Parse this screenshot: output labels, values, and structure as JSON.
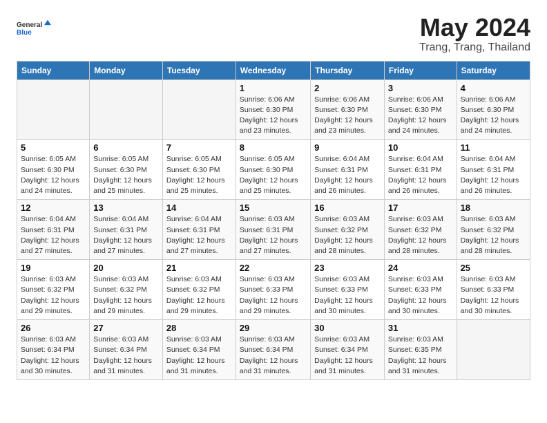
{
  "header": {
    "logo_general": "General",
    "logo_blue": "Blue",
    "month_title": "May 2024",
    "location": "Trang, Trang, Thailand"
  },
  "weekdays": [
    "Sunday",
    "Monday",
    "Tuesday",
    "Wednesday",
    "Thursday",
    "Friday",
    "Saturday"
  ],
  "weeks": [
    [
      {
        "day": "",
        "info": ""
      },
      {
        "day": "",
        "info": ""
      },
      {
        "day": "",
        "info": ""
      },
      {
        "day": "1",
        "info": "Sunrise: 6:06 AM\nSunset: 6:30 PM\nDaylight: 12 hours\nand 23 minutes."
      },
      {
        "day": "2",
        "info": "Sunrise: 6:06 AM\nSunset: 6:30 PM\nDaylight: 12 hours\nand 23 minutes."
      },
      {
        "day": "3",
        "info": "Sunrise: 6:06 AM\nSunset: 6:30 PM\nDaylight: 12 hours\nand 24 minutes."
      },
      {
        "day": "4",
        "info": "Sunrise: 6:06 AM\nSunset: 6:30 PM\nDaylight: 12 hours\nand 24 minutes."
      }
    ],
    [
      {
        "day": "5",
        "info": "Sunrise: 6:05 AM\nSunset: 6:30 PM\nDaylight: 12 hours\nand 24 minutes."
      },
      {
        "day": "6",
        "info": "Sunrise: 6:05 AM\nSunset: 6:30 PM\nDaylight: 12 hours\nand 25 minutes."
      },
      {
        "day": "7",
        "info": "Sunrise: 6:05 AM\nSunset: 6:30 PM\nDaylight: 12 hours\nand 25 minutes."
      },
      {
        "day": "8",
        "info": "Sunrise: 6:05 AM\nSunset: 6:30 PM\nDaylight: 12 hours\nand 25 minutes."
      },
      {
        "day": "9",
        "info": "Sunrise: 6:04 AM\nSunset: 6:31 PM\nDaylight: 12 hours\nand 26 minutes."
      },
      {
        "day": "10",
        "info": "Sunrise: 6:04 AM\nSunset: 6:31 PM\nDaylight: 12 hours\nand 26 minutes."
      },
      {
        "day": "11",
        "info": "Sunrise: 6:04 AM\nSunset: 6:31 PM\nDaylight: 12 hours\nand 26 minutes."
      }
    ],
    [
      {
        "day": "12",
        "info": "Sunrise: 6:04 AM\nSunset: 6:31 PM\nDaylight: 12 hours\nand 27 minutes."
      },
      {
        "day": "13",
        "info": "Sunrise: 6:04 AM\nSunset: 6:31 PM\nDaylight: 12 hours\nand 27 minutes."
      },
      {
        "day": "14",
        "info": "Sunrise: 6:04 AM\nSunset: 6:31 PM\nDaylight: 12 hours\nand 27 minutes."
      },
      {
        "day": "15",
        "info": "Sunrise: 6:03 AM\nSunset: 6:31 PM\nDaylight: 12 hours\nand 27 minutes."
      },
      {
        "day": "16",
        "info": "Sunrise: 6:03 AM\nSunset: 6:32 PM\nDaylight: 12 hours\nand 28 minutes."
      },
      {
        "day": "17",
        "info": "Sunrise: 6:03 AM\nSunset: 6:32 PM\nDaylight: 12 hours\nand 28 minutes."
      },
      {
        "day": "18",
        "info": "Sunrise: 6:03 AM\nSunset: 6:32 PM\nDaylight: 12 hours\nand 28 minutes."
      }
    ],
    [
      {
        "day": "19",
        "info": "Sunrise: 6:03 AM\nSunset: 6:32 PM\nDaylight: 12 hours\nand 29 minutes."
      },
      {
        "day": "20",
        "info": "Sunrise: 6:03 AM\nSunset: 6:32 PM\nDaylight: 12 hours\nand 29 minutes."
      },
      {
        "day": "21",
        "info": "Sunrise: 6:03 AM\nSunset: 6:32 PM\nDaylight: 12 hours\nand 29 minutes."
      },
      {
        "day": "22",
        "info": "Sunrise: 6:03 AM\nSunset: 6:33 PM\nDaylight: 12 hours\nand 29 minutes."
      },
      {
        "day": "23",
        "info": "Sunrise: 6:03 AM\nSunset: 6:33 PM\nDaylight: 12 hours\nand 30 minutes."
      },
      {
        "day": "24",
        "info": "Sunrise: 6:03 AM\nSunset: 6:33 PM\nDaylight: 12 hours\nand 30 minutes."
      },
      {
        "day": "25",
        "info": "Sunrise: 6:03 AM\nSunset: 6:33 PM\nDaylight: 12 hours\nand 30 minutes."
      }
    ],
    [
      {
        "day": "26",
        "info": "Sunrise: 6:03 AM\nSunset: 6:34 PM\nDaylight: 12 hours\nand 30 minutes."
      },
      {
        "day": "27",
        "info": "Sunrise: 6:03 AM\nSunset: 6:34 PM\nDaylight: 12 hours\nand 31 minutes."
      },
      {
        "day": "28",
        "info": "Sunrise: 6:03 AM\nSunset: 6:34 PM\nDaylight: 12 hours\nand 31 minutes."
      },
      {
        "day": "29",
        "info": "Sunrise: 6:03 AM\nSunset: 6:34 PM\nDaylight: 12 hours\nand 31 minutes."
      },
      {
        "day": "30",
        "info": "Sunrise: 6:03 AM\nSunset: 6:34 PM\nDaylight: 12 hours\nand 31 minutes."
      },
      {
        "day": "31",
        "info": "Sunrise: 6:03 AM\nSunset: 6:35 PM\nDaylight: 12 hours\nand 31 minutes."
      },
      {
        "day": "",
        "info": ""
      }
    ]
  ]
}
